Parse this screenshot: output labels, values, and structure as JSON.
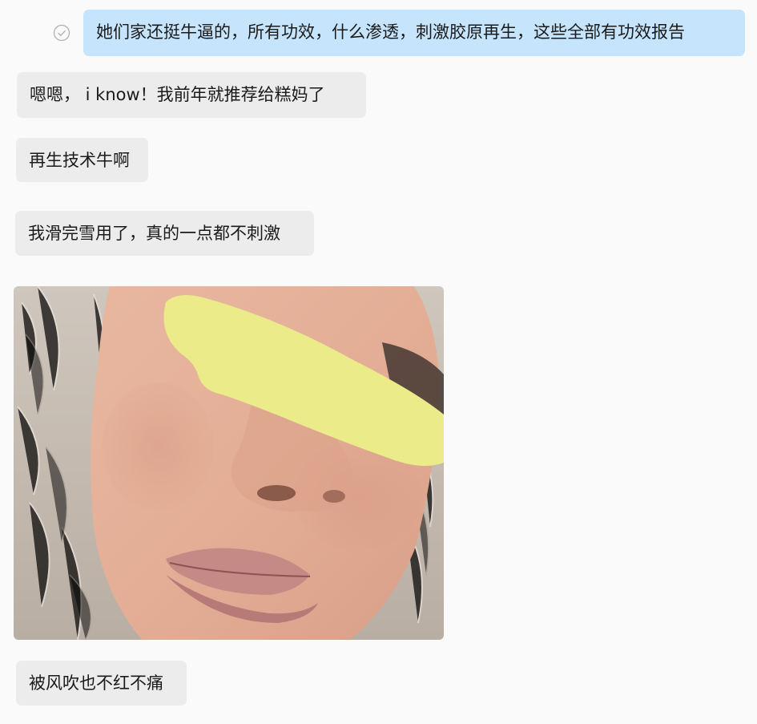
{
  "messages": [
    {
      "id": "m1",
      "side": "out",
      "text": "她们家还挺牛逼的，所有功效，什么渗透，刺激胶原再生，这些全部有功效报告",
      "status": "read-check-icon"
    },
    {
      "id": "m2",
      "side": "in",
      "text": "嗯嗯， i know！我前年就推荐给糕妈了"
    },
    {
      "id": "m3",
      "side": "in",
      "text": "再生技术牛啊"
    },
    {
      "id": "m4",
      "side": "in",
      "text": "我滑完雪用了，真的一点都不刺激"
    },
    {
      "id": "m5",
      "side": "in",
      "type": "image",
      "content": "photo-face-closeup"
    },
    {
      "id": "m6",
      "side": "in",
      "text": "被风吹也不红不痛"
    }
  ],
  "colors": {
    "background": "#fafafa",
    "incoming_bubble": "#ececec",
    "outgoing_bubble": "#c6e4fb",
    "text": "#1a1a1a",
    "redaction": "#ebeb8a"
  }
}
